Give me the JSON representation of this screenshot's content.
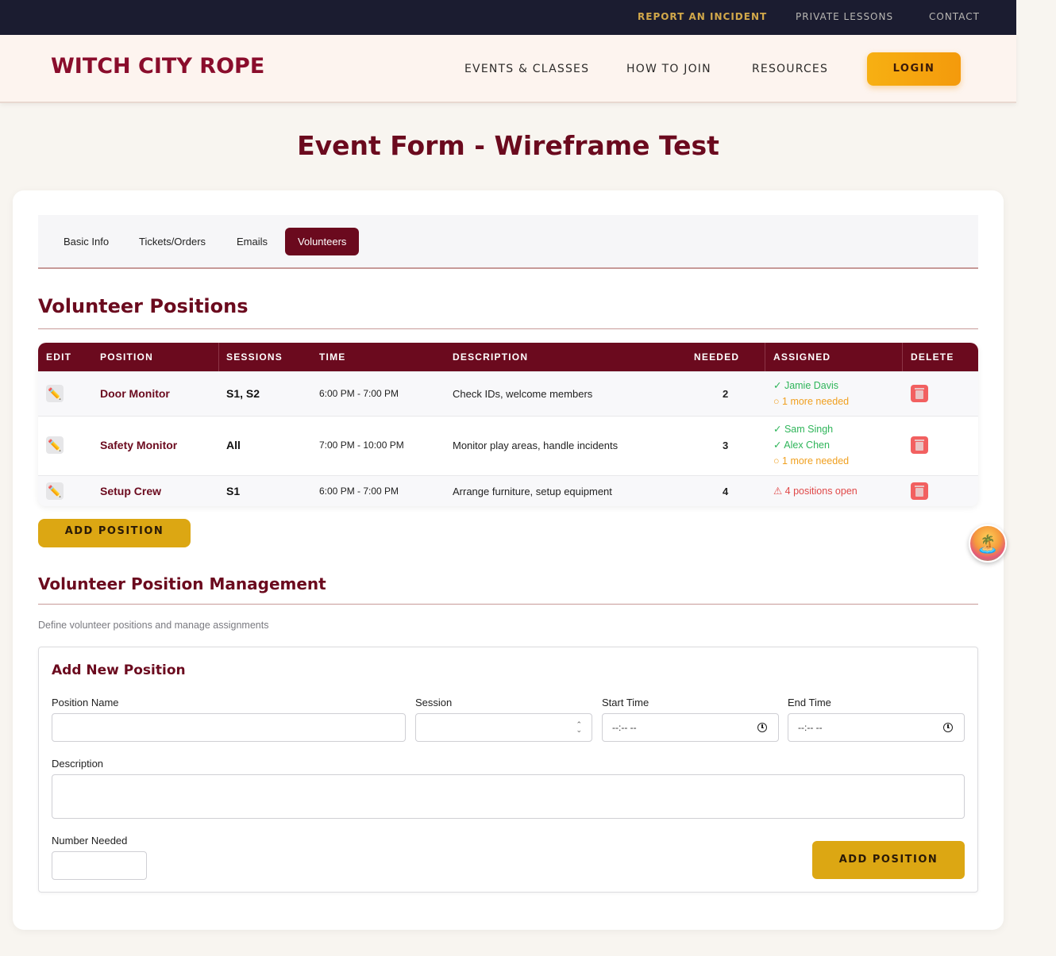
{
  "utility_nav": {
    "report_incident": "REPORT AN INCIDENT",
    "private_lessons": "PRIVATE LESSONS",
    "contact": "CONTACT"
  },
  "header": {
    "logo": "WITCH CITY ROPE",
    "nav": [
      "EVENTS & CLASSES",
      "HOW TO JOIN",
      "RESOURCES"
    ],
    "login": "LOGIN"
  },
  "page": {
    "title": "Event Form - Wireframe Test"
  },
  "tabs": [
    "Basic Info",
    "Tickets/Orders",
    "Emails",
    "Volunteers"
  ],
  "active_tab": "Volunteers",
  "positions_section": {
    "title": "Volunteer Positions",
    "columns": [
      "EDIT",
      "POSITION",
      "SESSIONS",
      "TIME",
      "DESCRIPTION",
      "NEEDED",
      "ASSIGNED",
      "DELETE"
    ],
    "rows": [
      {
        "position": "Door Monitor",
        "sessions": "S1, S2",
        "time": "6:00 PM - 7:00 PM",
        "description": "Check IDs, welcome members",
        "needed": "2",
        "assigned": [
          "✓ Jamie Davis",
          "○ 1 more needed"
        ]
      },
      {
        "position": "Safety Monitor",
        "sessions": "All",
        "time": "7:00 PM - 10:00 PM",
        "description": "Monitor play areas, handle incidents",
        "needed": "3",
        "assigned": [
          "✓ Sam Singh",
          "✓ Alex Chen",
          "○ 1 more needed"
        ]
      },
      {
        "position": "Setup Crew",
        "sessions": "S1",
        "time": "6:00 PM - 7:00 PM",
        "description": "Arrange furniture, setup equipment",
        "needed": "4",
        "assigned": [
          "⚠ 4 positions open"
        ]
      }
    ],
    "add_button": "ADD POSITION"
  },
  "management": {
    "title": "Volunteer Position Management",
    "description": "Define volunteer positions and manage assignments",
    "form": {
      "title": "Add New Position",
      "position_name_label": "Position Name",
      "session_label": "Session",
      "start_time_label": "Start Time",
      "end_time_label": "End Time",
      "time_placeholder": "--:-- --",
      "description_label": "Description",
      "number_needed_label": "Number Needed",
      "submit": "ADD POSITION"
    }
  },
  "colors": {
    "brand": "#6b0a1e",
    "accent": "#dca713",
    "success": "#2fb55a",
    "pending": "#f0a020",
    "danger": "#e04848"
  },
  "icons": {
    "edit": "pencil-icon",
    "delete": "trash-icon",
    "clock": "clock-icon",
    "floating": "island-icon"
  }
}
